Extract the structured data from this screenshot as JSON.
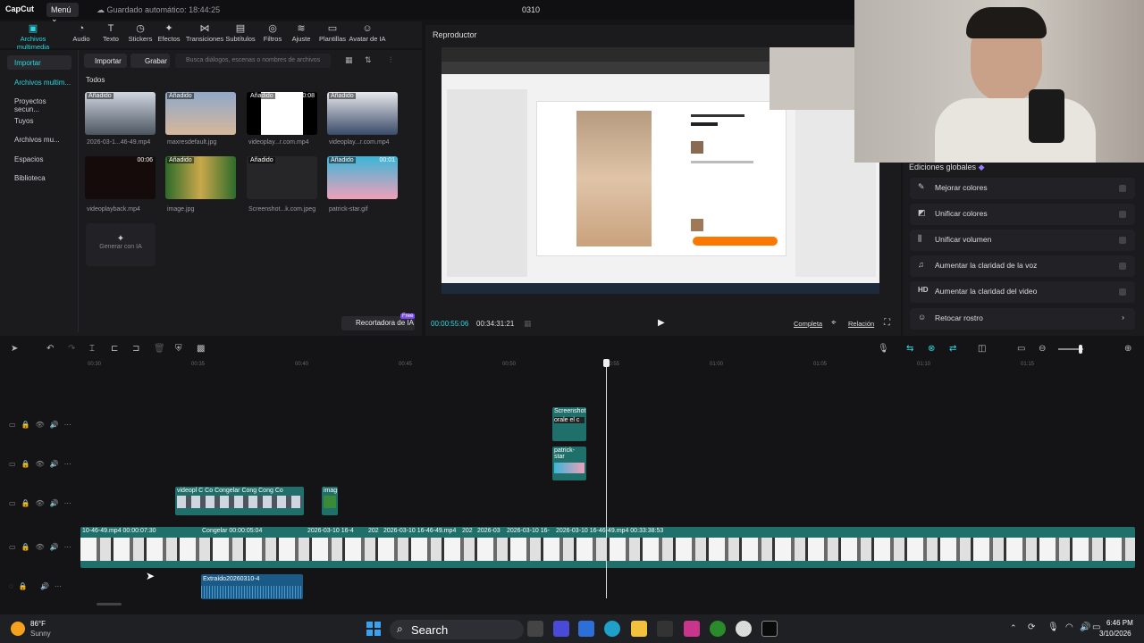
{
  "app": {
    "logo": "CapCut",
    "menu_label": "Menú",
    "autosave": "Guardado automático: 18:44:25",
    "project_title": "0310"
  },
  "toolbar": {
    "items": [
      {
        "label": "Archivos multimedia",
        "icon": "media-icon"
      },
      {
        "label": "Audio",
        "icon": "audio-icon"
      },
      {
        "label": "Texto",
        "icon": "text-icon"
      },
      {
        "label": "Stickers",
        "icon": "sticker-icon"
      },
      {
        "label": "Efectos",
        "icon": "effects-icon"
      },
      {
        "label": "Transiciones",
        "icon": "transitions-icon"
      },
      {
        "label": "Subtítulos",
        "icon": "subtitles-icon"
      },
      {
        "label": "Filtros",
        "icon": "filters-icon"
      },
      {
        "label": "Ajuste",
        "icon": "adjust-icon"
      },
      {
        "label": "Plantillas",
        "icon": "templates-icon"
      },
      {
        "label": "Avatar de IA",
        "icon": "avatar-icon"
      }
    ]
  },
  "media": {
    "sidebar": [
      {
        "label": "Importar"
      },
      {
        "label": "Archivos multim..."
      },
      {
        "label": "Proyectos secun..."
      },
      {
        "label": "Tuyos"
      },
      {
        "label": "Archivos mu..."
      },
      {
        "label": "Espacios"
      },
      {
        "label": "Biblioteca"
      }
    ],
    "import_label": "Importar",
    "record_label": "Grabar",
    "search_placeholder": "Busca diálogos, escenas o nombres de archivos",
    "filter_all": "Todos",
    "added_badge": "Añadido",
    "files": [
      {
        "name": "2026-03-1...46-49.mp4",
        "duration": ""
      },
      {
        "name": "maxresdefault.jpg",
        "duration": ""
      },
      {
        "name": "videoplay...r.com.mp4",
        "duration": "00:08"
      },
      {
        "name": "videoplay...r.com.mp4",
        "duration": ""
      },
      {
        "name": "videoplayback.mp4",
        "duration": "00:06"
      },
      {
        "name": "image.jpg",
        "duration": ""
      },
      {
        "name": "Screenshot...k.com.jpeg",
        "duration": ""
      },
      {
        "name": "patrick-star.gif",
        "duration": "00:01"
      }
    ],
    "generate_ai": "Generar con IA",
    "cutout_label": "Recortadora de IA",
    "free_tag": "Free"
  },
  "player": {
    "title": "Reproductor",
    "current_time": "00:00:55:06",
    "total_time": "00:34:31:21",
    "full_label": "Completa",
    "ratio_label": "Relación"
  },
  "global_edits": {
    "title": "Ediciones globales",
    "options": [
      {
        "label": "Mejorar colores",
        "icon": "palette-icon"
      },
      {
        "label": "Unificar colores",
        "icon": "color-unify-icon"
      },
      {
        "label": "Unificar volumen",
        "icon": "volume-bars-icon"
      },
      {
        "label": "Aumentar la claridad de la voz",
        "icon": "voice-icon"
      },
      {
        "label": "Aumentar la claridad del video",
        "icon": "hd-icon"
      },
      {
        "label": "Retocar rostro",
        "icon": "face-icon"
      }
    ]
  },
  "timeline": {
    "ruler_ticks": [
      "00:30",
      "00:35",
      "00:40",
      "00:45",
      "00:50",
      "00:55",
      "01:00",
      "01:05",
      "01:10",
      "01:15"
    ],
    "main_labels": [
      "10-46-49.mp4  00:00:07:30",
      "Congelar  00:00:05:04",
      "2026-03-10 16-4",
      "202",
      "2026-03-10 16-46-49.mp4",
      "202",
      "2026-03",
      "2026-03-10 16-",
      "2026-03-10 16-46-49.mp4  00:33:38:53"
    ],
    "overlay_labels": [
      "Screenshot",
      "orale el c",
      "patrick-star",
      "videopl",
      "C",
      "Co",
      "Congelar",
      "Cong",
      "Cong",
      "Co",
      "imag"
    ],
    "audio_label": "Extraído20260310-4"
  },
  "taskbar": {
    "temperature": "86°F",
    "weather": "Sunny",
    "search": "Search",
    "time": "6:46 PM",
    "date": "3/10/2026"
  }
}
